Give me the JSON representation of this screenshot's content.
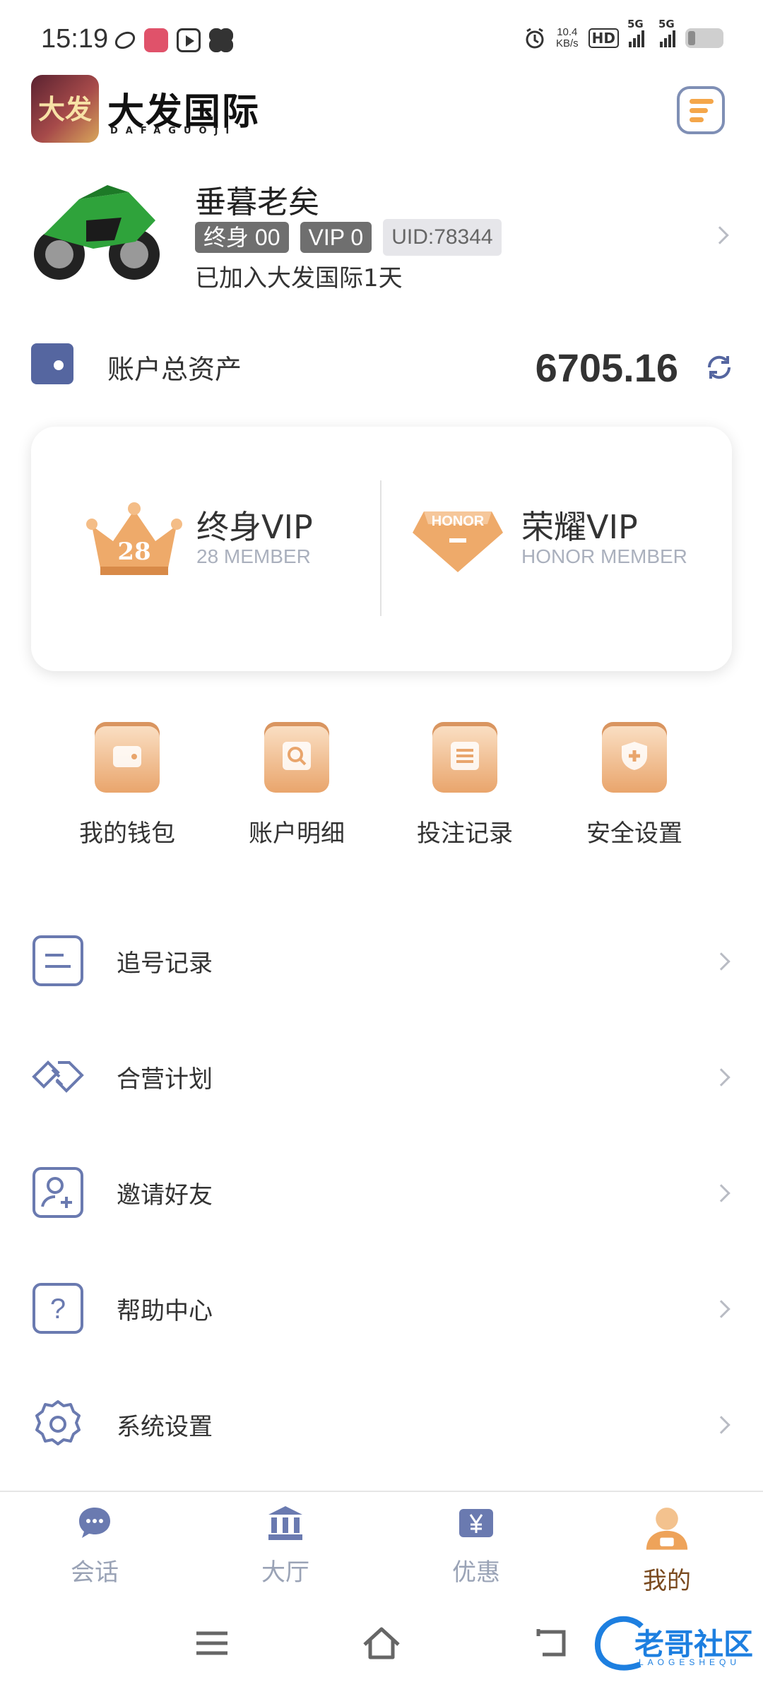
{
  "status_bar": {
    "time": "15:19",
    "net_speed_value": "10.4",
    "net_speed_unit": "KB/s",
    "hd": "HD",
    "sim1": "5G",
    "sim2": "5G"
  },
  "header": {
    "logo_text": "大发国际",
    "logo_subtext": "DAFAGUOJI",
    "logo_badge": "大发"
  },
  "profile": {
    "name": "垂暮老矣",
    "tags": [
      "终身 00",
      "VIP 0"
    ],
    "uid": "UID:78344",
    "joined": "已加入大发国际1天"
  },
  "assets": {
    "label": "账户总资产",
    "value": "6705.16"
  },
  "vip": [
    {
      "badge": "28",
      "title": "终身VIP",
      "subtitle": "28 MEMBER"
    },
    {
      "badge": "HONOR",
      "title": "荣耀VIP",
      "subtitle": "HONOR MEMBER"
    }
  ],
  "quick_actions": [
    {
      "label": "我的钱包",
      "icon": "wallet-icon"
    },
    {
      "label": "账户明细",
      "icon": "search-icon"
    },
    {
      "label": "投注记录",
      "icon": "list-icon"
    },
    {
      "label": "安全设置",
      "icon": "shield-icon"
    }
  ],
  "menu": [
    {
      "label": "追号记录",
      "icon": "record-icon"
    },
    {
      "label": "合营计划",
      "icon": "handshake-icon"
    },
    {
      "label": "邀请好友",
      "icon": "add-user-icon"
    },
    {
      "label": "帮助中心",
      "icon": "help-icon"
    },
    {
      "label": "系统设置",
      "icon": "gear-icon"
    }
  ],
  "bottom_nav": [
    {
      "label": "会话",
      "icon": "chat-icon"
    },
    {
      "label": "大厅",
      "icon": "bank-icon"
    },
    {
      "label": "优惠",
      "icon": "yen-icon"
    },
    {
      "label": "我的",
      "icon": "user-icon",
      "active": true
    }
  ],
  "watermark": {
    "text": "老哥社区",
    "subtext": "LAOGESHEQU"
  },
  "colors": {
    "accent_blue": "#5566a0",
    "gold": "#e9a56c",
    "nav_inactive": "#9aa3b6",
    "nav_active": "#7a4a1f"
  }
}
